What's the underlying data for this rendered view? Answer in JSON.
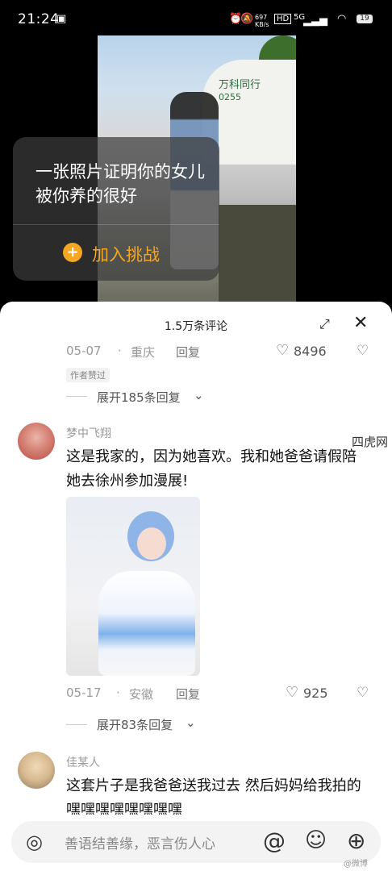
{
  "status_bar": {
    "time": "21:24",
    "net_speed": "697 KB/s",
    "hd": "HD",
    "signal": "5G",
    "battery": "19"
  },
  "video": {
    "building_sign": "万科同行",
    "building_number": "0255"
  },
  "challenge": {
    "text": "一张照片证明你的女儿被你养的很好",
    "join_label": "加入挑战",
    "plus": "+"
  },
  "comments_sheet": {
    "title": "1.5万条评论",
    "comments": [
      {
        "date": "05-07",
        "location": "重庆",
        "reply_label": "回复",
        "likes": "8496",
        "author_tag": "作者赞过",
        "expand_replies": "展开185条回复"
      },
      {
        "username": "梦中飞翔",
        "text": "这是我家的，因为她喜欢。我和她爸爸请假陪她去徐州参加漫展!",
        "date": "05-17",
        "location": "安徽",
        "reply_label": "回复",
        "likes": "925",
        "expand_replies": "展开83条回复"
      },
      {
        "username": "佳某人",
        "text": "这套片子是我爸爸送我过去 然后妈妈给我拍的嘿嘿嘿嘿嘿嘿嘿嘿"
      }
    ]
  },
  "side_watermark": "四虎网",
  "input_bar": {
    "placeholder": "善语结善缘，恶言伤人心"
  },
  "weibo_watermark": "@微博"
}
